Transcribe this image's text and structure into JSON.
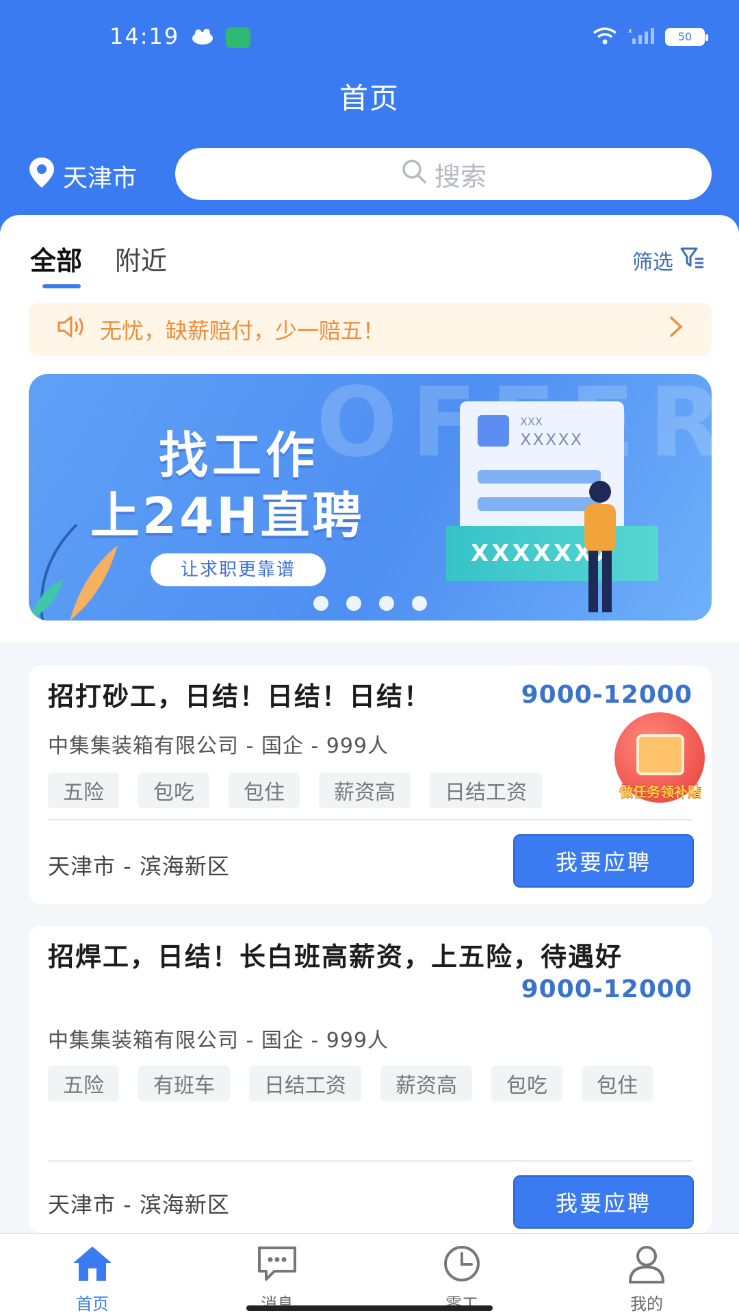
{
  "status_bar": {
    "time": "14:19",
    "battery": "50"
  },
  "header": {
    "title": "首页",
    "location": "天津市",
    "search_placeholder": "搜索"
  },
  "tabs": [
    {
      "label": "全部",
      "active": true
    },
    {
      "label": "附近",
      "active": false
    }
  ],
  "filter_label": "筛选",
  "notice": {
    "text": "无忧，缺薪赔付，少一赔五！"
  },
  "banner": {
    "watermark": "OFFER",
    "line1": "找工作",
    "line2": "上24H直聘",
    "pill": "让求职更靠谱",
    "card_small": "XXX",
    "card_name": "XXXXX",
    "card_strip": "XXXXXXX"
  },
  "jobs": [
    {
      "title": "招打砂工，日结！日结！日结！",
      "salary": "9000-12000",
      "company": "中集集装箱有限公司 - 国企 - 999人",
      "tags": [
        "五险",
        "包吃",
        "包住",
        "薪资高",
        "日结工资"
      ],
      "address": "天津市 - 滨海新区",
      "apply_label": "我要应聘"
    },
    {
      "title": "招焊工，日结！长白班高薪资，上五险，待遇好",
      "salary": "9000-12000",
      "company": "中集集装箱有限公司 - 国企 - 999人",
      "tags": [
        "五险",
        "有班车",
        "日结工资",
        "薪资高",
        "包吃",
        "包住"
      ],
      "address": "天津市 - 滨海新区",
      "apply_label": "我要应聘"
    }
  ],
  "gift": {
    "label": "做任务领补贴"
  },
  "bottom_nav": [
    {
      "label": "首页",
      "icon": "home-icon",
      "active": true
    },
    {
      "label": "消息",
      "icon": "message-icon",
      "active": false
    },
    {
      "label": "零工",
      "icon": "clock-icon",
      "active": false
    },
    {
      "label": "我的",
      "icon": "user-icon",
      "active": false
    }
  ],
  "colors": {
    "primary": "#3b7bf2",
    "salary": "#3a73c9",
    "notice": "#f08c3a"
  }
}
